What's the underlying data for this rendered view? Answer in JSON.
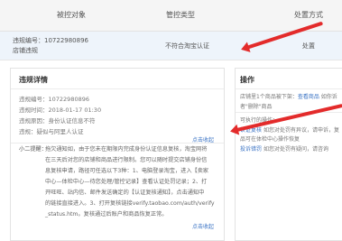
{
  "table": {
    "headers": [
      "被控对象",
      "管控类型",
      "处置方式"
    ],
    "row": {
      "object_line1": "违规编号：10722980896",
      "object_line2": "店铺违规",
      "type": "不符合淘宝认证",
      "action": "处置"
    }
  },
  "detail": {
    "title": "违规详情",
    "fields": [
      "违规编号：10722980896",
      "违规时间：2018-01-17 01:30",
      "违规原因：身份认证信息不符",
      "违规：疑似与阿里人认证"
    ],
    "collapse_1": "点击收起",
    "tips_label": "小二提醒：",
    "tips_lines": [
      "拖欠通知如，由于您未在期限内完成身份认证信息复核，淘宝网将",
      "在三天后对您的店铺和商品进行限制。您可以随时提交店铺身份信",
      "息复核申请，路径可任选以下3种：1、电脑登录淘宝，进入【卖家",
      "中心—体检中心—待您处理/管控记录】查看认证处罚记录；2、打",
      "开旺旺、站内信、邮件发送确定的【认证复核通知】，点击通知中",
      "的链接直接进入。3、打开复核链接verify.taobao.com/auth/verify",
      "_status.htm。复核通过后账户和商品恢复正常。"
    ],
    "collapse_2": "点击收起"
  },
  "operation": {
    "title": "操作",
    "notice_prefix": "店铺里1个商品被下架：",
    "notice_link": "查看商品",
    "notice_suffix": "如你诉",
    "notice_line2": "者\"删除\"商品",
    "executable_label": "可执行的操作：",
    "ops": [
      {
        "link": "认证复核",
        "desc": "如您对处罚有异议，请申诉，复"
      },
      {
        "link": "",
        "desc": "品可在体检中心操作恢复"
      },
      {
        "link": "投诉错罚",
        "desc": "如您对处罚有疑问，请咨询"
      }
    ]
  },
  "colors": {
    "link": "#3a73c4",
    "arrow": "#e32b2b",
    "header_bg": "#f5f5f5",
    "row_bg": "#eef4fb"
  }
}
